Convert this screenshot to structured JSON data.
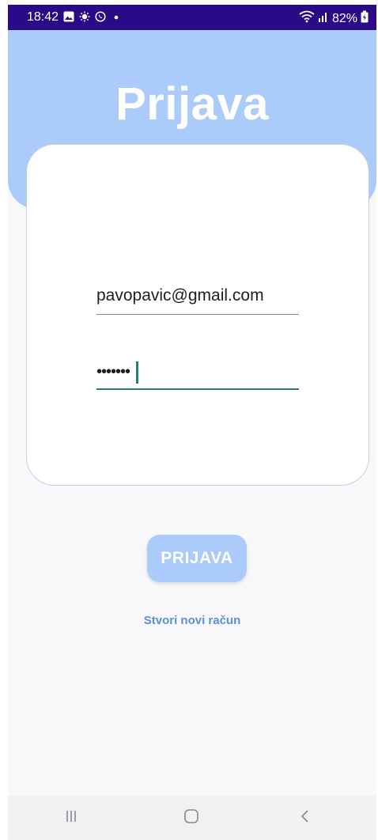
{
  "status_bar": {
    "time": "18:42",
    "battery": "82%"
  },
  "header": {
    "title": "Prijava"
  },
  "form": {
    "email_value": "pavopavic@gmail.com",
    "password_masked": "•••••••"
  },
  "actions": {
    "login_label": "PRIJAVA",
    "register_label": "Stvori novi račun"
  },
  "colors": {
    "status_bar": "#2a0a86",
    "header": "#abcbfa",
    "accent_underline": "#24806f",
    "link": "#5d8fd6"
  },
  "icons": {
    "status_left": [
      "image-icon",
      "sun-icon",
      "whatsapp-icon",
      "dot-icon"
    ],
    "status_right": [
      "wifi-icon",
      "signal-icon",
      "battery-icon"
    ],
    "nav": [
      "recent-apps-icon",
      "home-icon",
      "back-icon"
    ]
  }
}
